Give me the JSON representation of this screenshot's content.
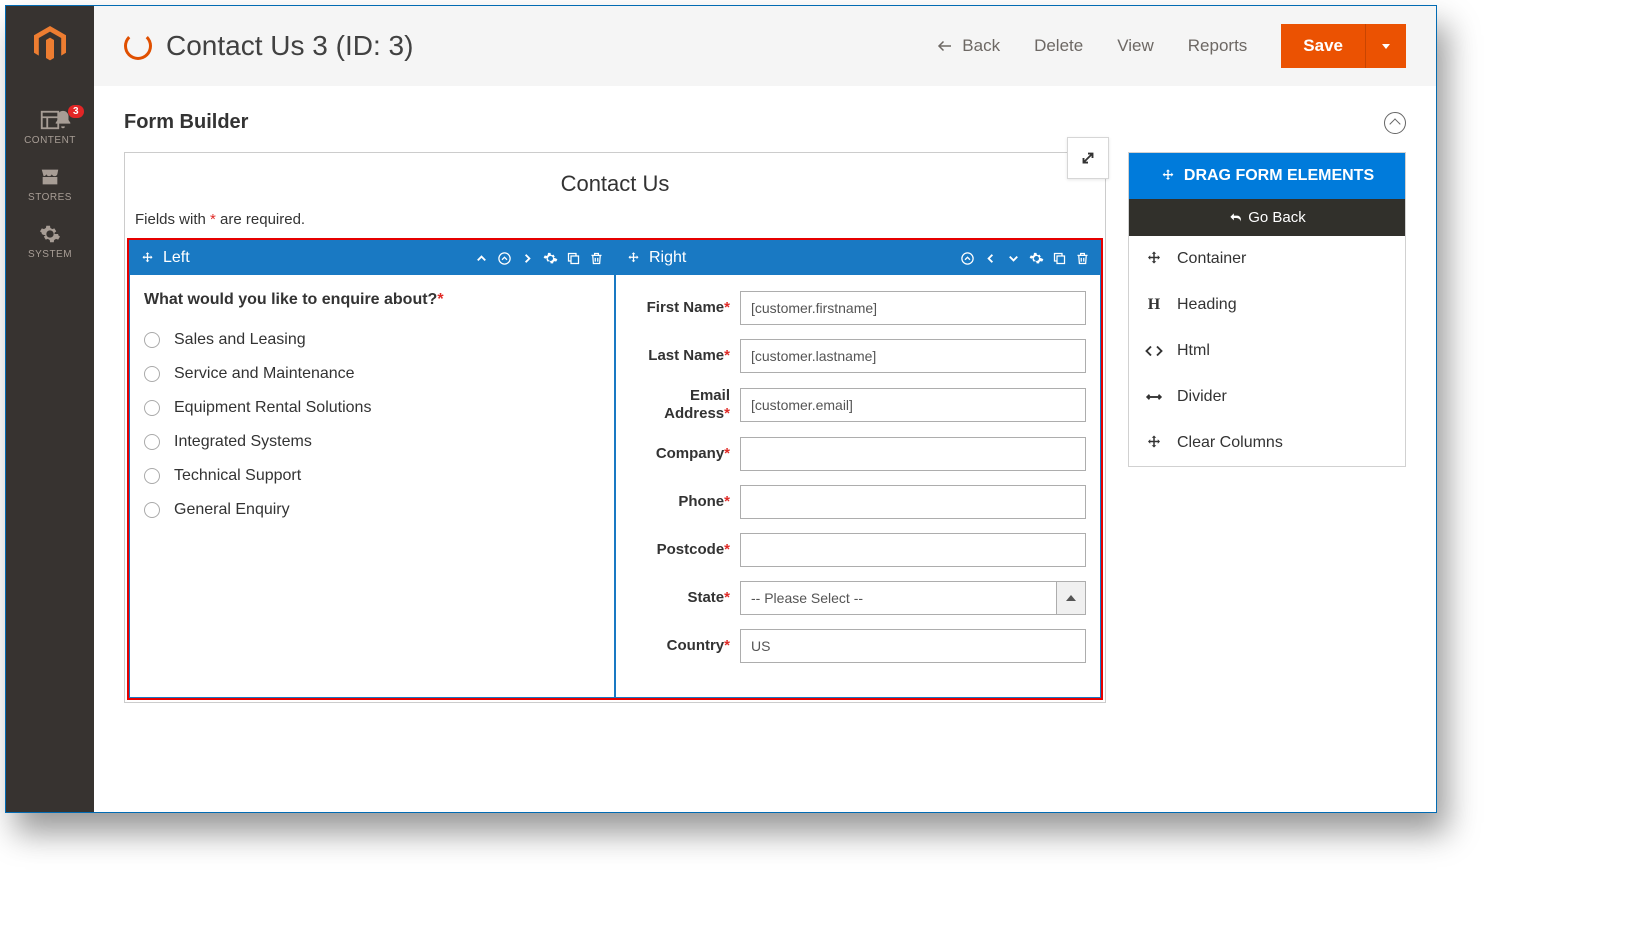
{
  "sidebar": {
    "items": [
      {
        "label": "CONTENT"
      },
      {
        "label": "STORES"
      },
      {
        "label": "SYSTEM"
      }
    ],
    "badge": "3"
  },
  "header": {
    "title": "Contact Us 3 (ID: 3)",
    "back": "Back",
    "delete": "Delete",
    "view": "View",
    "reports": "Reports",
    "save": "Save"
  },
  "section": {
    "title": "Form Builder"
  },
  "canvas": {
    "title": "Contact Us",
    "required_note_pre": "Fields with ",
    "required_note_post": " are required.",
    "left": {
      "title": "Left",
      "question": "What would you like to enquire about?",
      "options": [
        "Sales and Leasing",
        "Service and Maintenance",
        "Equipment Rental Solutions",
        "Integrated Systems",
        "Technical Support",
        "General Enquiry"
      ]
    },
    "right": {
      "title": "Right",
      "fields": [
        {
          "label": "First Name",
          "value": "[customer.firstname]"
        },
        {
          "label": "Last Name",
          "value": "[customer.lastname]"
        },
        {
          "label": "Email Address",
          "value": "[customer.email]"
        },
        {
          "label": "Company",
          "value": ""
        },
        {
          "label": "Phone",
          "value": ""
        },
        {
          "label": "Postcode",
          "value": ""
        },
        {
          "label": "State",
          "value": "-- Please Select --",
          "select": true
        },
        {
          "label": "Country",
          "value": "US"
        }
      ]
    }
  },
  "palette": {
    "title": "DRAG FORM ELEMENTS",
    "back": "Go Back",
    "items": [
      {
        "label": "Container",
        "icon": "move"
      },
      {
        "label": "Heading",
        "icon": "H"
      },
      {
        "label": "Html",
        "icon": "code"
      },
      {
        "label": "Divider",
        "icon": "arrow-h"
      },
      {
        "label": "Clear Columns",
        "icon": "move"
      }
    ]
  }
}
